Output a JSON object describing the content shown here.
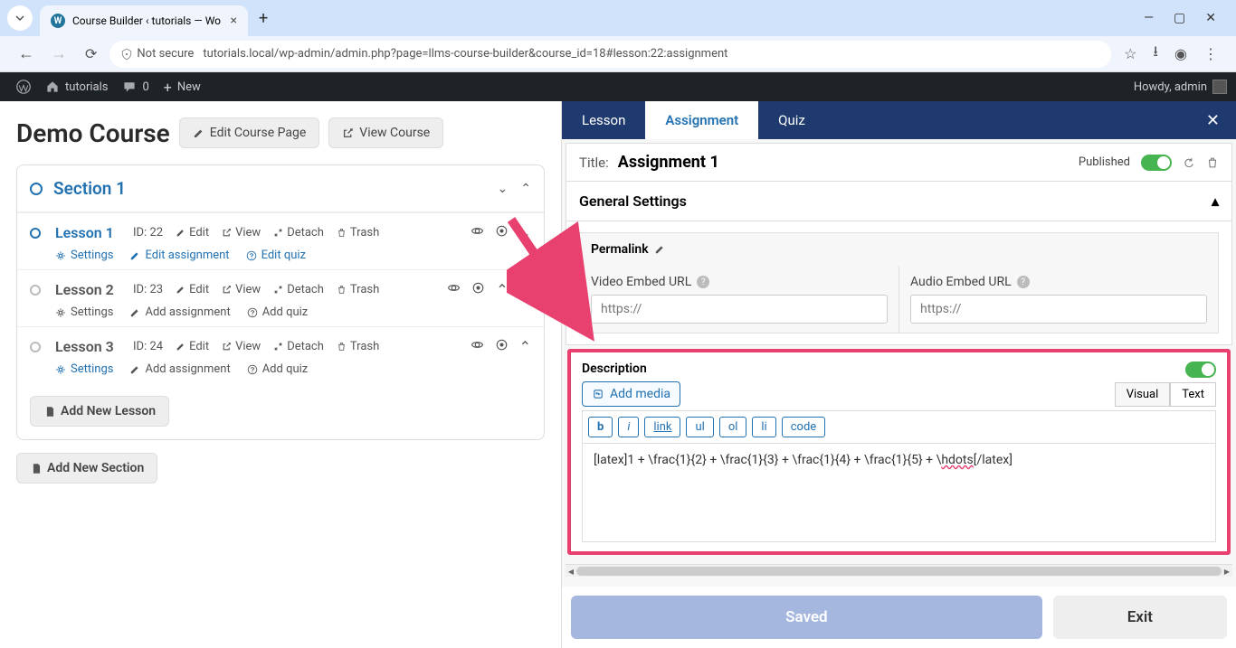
{
  "browser": {
    "tab_title": "Course Builder ‹ tutorials — Wo",
    "security_label": "Not secure",
    "url": "tutorials.local/wp-admin/admin.php?page=llms-course-builder&course_id=18#lesson:22:assignment"
  },
  "wpbar": {
    "site": "tutorials",
    "comments": "0",
    "new": "New",
    "greeting": "Howdy, admin"
  },
  "course": {
    "title": "Demo Course",
    "edit_page": "Edit Course Page",
    "view_course": "View Course",
    "section": {
      "title": "Section 1"
    },
    "lessons": [
      {
        "title": "Lesson 1",
        "id": "ID: 22",
        "edit": "Edit",
        "view": "View",
        "detach": "Detach",
        "trash": "Trash",
        "settings": "Settings",
        "assignment": "Edit assignment",
        "quiz": "Edit quiz"
      },
      {
        "title": "Lesson 2",
        "id": "ID: 23",
        "edit": "Edit",
        "view": "View",
        "detach": "Detach",
        "trash": "Trash",
        "settings": "Settings",
        "assignment": "Add assignment",
        "quiz": "Add quiz"
      },
      {
        "title": "Lesson 3",
        "id": "ID: 24",
        "edit": "Edit",
        "view": "View",
        "detach": "Detach",
        "trash": "Trash",
        "settings": "Settings",
        "assignment": "Add assignment",
        "quiz": "Add quiz"
      }
    ],
    "add_lesson": "Add New Lesson",
    "add_section": "Add New Section"
  },
  "panel": {
    "tabs": {
      "lesson": "Lesson",
      "assignment": "Assignment",
      "quiz": "Quiz"
    },
    "title_label": "Title:",
    "title_value": "Assignment 1",
    "published": "Published",
    "general_settings": "General Settings",
    "permalink": "Permalink",
    "video_label": "Video Embed URL",
    "audio_label": "Audio Embed URL",
    "url_placeholder": "https://",
    "description": "Description",
    "add_media": "Add media",
    "editor_tabs": {
      "visual": "Visual",
      "text": "Text"
    },
    "toolbar": {
      "b": "b",
      "i": "i",
      "link": "link",
      "ul": "ul",
      "ol": "ol",
      "li": "li",
      "code": "code"
    },
    "editor_content_pre": "[latex]1 + \\frac{1}{2} + \\frac{1}{3} + \\frac{1}{4} + \\frac{1}{5} + \\",
    "editor_content_spell": "hdots",
    "editor_content_post": "[/latex]",
    "saved": "Saved",
    "exit": "Exit"
  }
}
